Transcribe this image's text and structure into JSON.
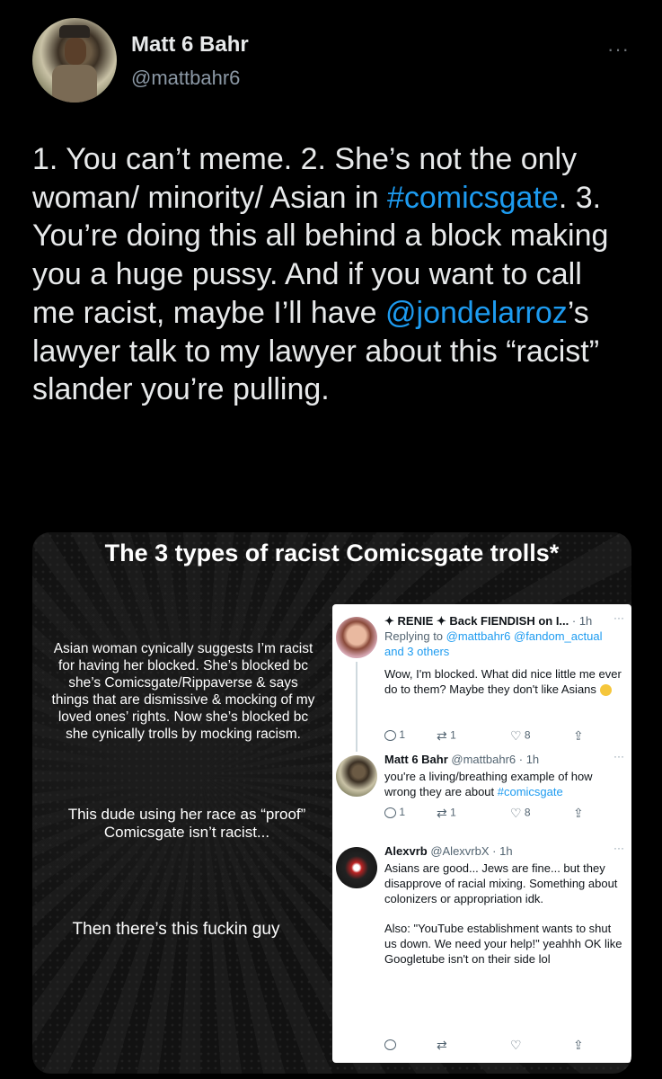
{
  "author": {
    "display_name": "Matt 6 Bahr",
    "handle": "@mattbahr6",
    "more": "···"
  },
  "tweet": {
    "p1": "1. You can’t meme. 2. She’s not the only woman/ minority/ Asian in ",
    "hashtag": "#comicsgate",
    "p2": ". 3. You’re doing this all behind a block making you a huge pussy. And if you want to call me racist, maybe I’ll have ",
    "mention": "@jondelarroz",
    "p3": "’s lawyer talk to my lawyer about this “racist” slander you’re pulling."
  },
  "meme": {
    "title": "The 3 types of racist Comicsgate trolls*",
    "caption1": "Asian woman cynically suggests I’m racist for having her blocked. She’s blocked bc she’s Comicsgate/Rippaverse & says things that are dismissive & mocking of my loved ones’ rights. Now she’s blocked bc she cynically trolls by mocking racism.",
    "caption2": "This dude using her race as “proof” Comicsgate isn’t racist...",
    "caption3": "Then there’s this fuckin guy"
  },
  "replies": [
    {
      "name": "✦ RENIE ✦ Back FIENDISH on I...",
      "meta": " · 1h",
      "replying_prefix": "Replying to ",
      "replying_to": "@mattbahr6 @fandom_actual",
      "replying_suffix": "and 3 others",
      "text": "Wow, I'm blocked. What did nice little me ever do to them? Maybe they don't like Asians",
      "replies": "1",
      "retweets": "1",
      "likes": "8"
    },
    {
      "name": "Matt 6 Bahr",
      "meta": " @mattbahr6 · 1h",
      "text": "you're a living/breathing example of how wrong they are about ",
      "hashtag": "#comicsgate",
      "replies": "1",
      "retweets": "1",
      "likes": "8"
    },
    {
      "name": "Alexvrb",
      "meta": " @AlexvrbX · 1h",
      "text1": "Asians are good... Jews are fine... but they disapprove of racial mixing. Something about colonizers or appropriation idk.",
      "text2": "Also: \"YouTube establishment wants to shut us down. We need your help!\" yeahhh OK like Googletube isn't on their side lol"
    }
  ],
  "icons": {
    "reply": "reply-icon",
    "retweet": "retweet-icon",
    "like": "heart-icon",
    "share": "share-icon"
  },
  "colors": {
    "background": "#000000",
    "link": "#1d9bf0",
    "text": "#e7e9ea",
    "muted": "#8b98a5"
  }
}
